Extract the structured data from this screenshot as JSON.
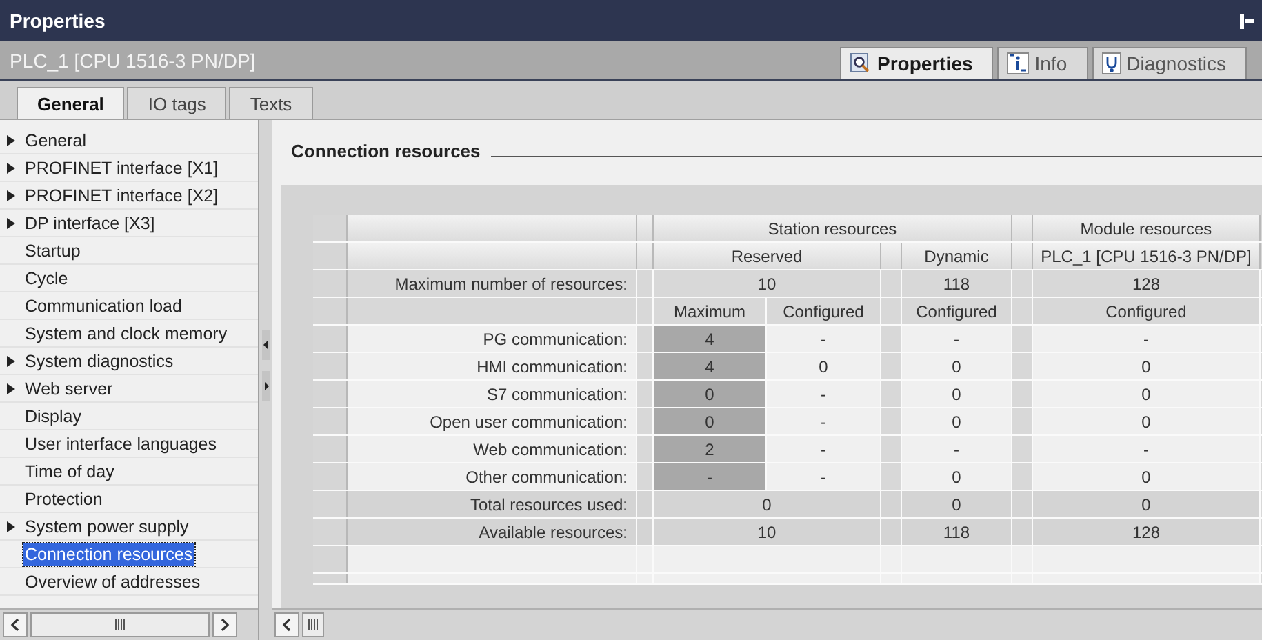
{
  "window": {
    "title": "Properties"
  },
  "object_bar": {
    "title": "PLC_1 [CPU 1516-3 PN/DP]",
    "tabs": [
      {
        "label": "Properties",
        "kind": "properties",
        "selected": true
      },
      {
        "label": "Info",
        "kind": "info",
        "selected": false
      },
      {
        "label": "Diagnostics",
        "kind": "diagnostics",
        "selected": false
      }
    ]
  },
  "tabs": [
    {
      "label": "General",
      "selected": true
    },
    {
      "label": "IO tags",
      "selected": false
    },
    {
      "label": "Texts",
      "selected": false
    }
  ],
  "tree": {
    "items": [
      {
        "label": "General",
        "expandable": true,
        "selected": false
      },
      {
        "label": "PROFINET interface [X1]",
        "expandable": true,
        "selected": false
      },
      {
        "label": "PROFINET interface [X2]",
        "expandable": true,
        "selected": false
      },
      {
        "label": "DP interface [X3]",
        "expandable": true,
        "selected": false
      },
      {
        "label": "Startup",
        "expandable": false,
        "selected": false
      },
      {
        "label": "Cycle",
        "expandable": false,
        "selected": false
      },
      {
        "label": "Communication load",
        "expandable": false,
        "selected": false
      },
      {
        "label": "System and clock memory",
        "expandable": false,
        "selected": false
      },
      {
        "label": "System diagnostics",
        "expandable": true,
        "selected": false
      },
      {
        "label": "Web server",
        "expandable": true,
        "selected": false
      },
      {
        "label": "Display",
        "expandable": false,
        "selected": false
      },
      {
        "label": "User interface languages",
        "expandable": false,
        "selected": false
      },
      {
        "label": "Time of day",
        "expandable": false,
        "selected": false
      },
      {
        "label": "Protection",
        "expandable": false,
        "selected": false
      },
      {
        "label": "System power supply",
        "expandable": true,
        "selected": false
      },
      {
        "label": "Connection resources",
        "expandable": false,
        "selected": true
      },
      {
        "label": "Overview of addresses",
        "expandable": false,
        "selected": false
      }
    ]
  },
  "section": {
    "title": "Connection resources"
  },
  "table": {
    "group_headers": [
      "Station resources",
      "Module resources"
    ],
    "sub_headers": [
      "Reserved",
      "Dynamic",
      "PLC_1 [CPU 1516-3 PN/DP]"
    ],
    "max_row": {
      "label": "Maximum number of resources:",
      "values": [
        "10",
        "118",
        "128"
      ]
    },
    "column_headers": [
      "Maximum",
      "Configured",
      "Configured",
      "Configured"
    ],
    "rows": [
      {
        "label": "PG communication:",
        "maximum": "4",
        "reserved": "-",
        "dynamic": "-",
        "module": "-"
      },
      {
        "label": "HMI communication:",
        "maximum": "4",
        "reserved": "0",
        "dynamic": "0",
        "module": "0"
      },
      {
        "label": "S7 communication:",
        "maximum": "0",
        "reserved": "-",
        "dynamic": "0",
        "module": "0"
      },
      {
        "label": "Open user communication:",
        "maximum": "0",
        "reserved": "-",
        "dynamic": "0",
        "module": "0"
      },
      {
        "label": "Web communication:",
        "maximum": "2",
        "reserved": "-",
        "dynamic": "-",
        "module": "-"
      },
      {
        "label": "Other communication:",
        "maximum": "-",
        "reserved": "-",
        "dynamic": "0",
        "module": "0"
      }
    ],
    "totals": [
      {
        "label": "Total resources used:",
        "values": [
          "0",
          "0",
          "0"
        ]
      },
      {
        "label": "Available resources:",
        "values": [
          "10",
          "118",
          "128"
        ]
      }
    ]
  }
}
